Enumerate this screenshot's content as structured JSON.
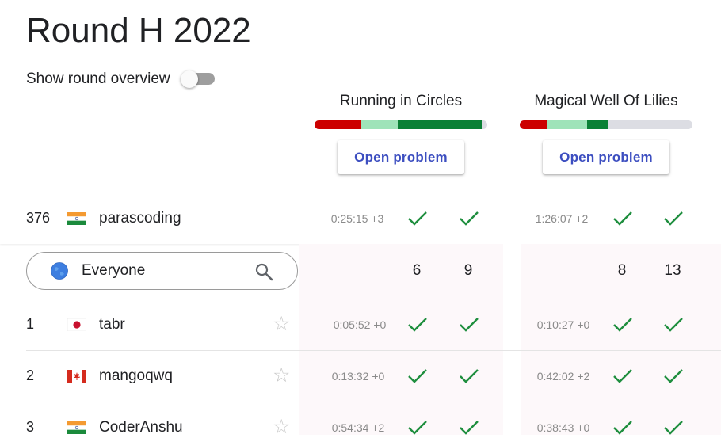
{
  "page": {
    "title": "Round H 2022"
  },
  "overview": {
    "label": "Show round overview",
    "toggle_on": false
  },
  "problems": [
    {
      "name": "Running in Circles",
      "button": "Open problem",
      "progress": [
        {
          "fraction": 0.27,
          "color": "#cc0000"
        },
        {
          "fraction": 0.21,
          "color": "#9fe3b9"
        },
        {
          "fraction": 0.49,
          "color": "#0a8035"
        }
      ]
    },
    {
      "name": "Magical Well Of Lilies",
      "button": "Open problem",
      "progress": [
        {
          "fraction": 0.16,
          "color": "#cc0000"
        },
        {
          "fraction": 0.23,
          "color": "#9fe3b9"
        },
        {
          "fraction": 0.12,
          "color": "#0a8035"
        }
      ]
    }
  ],
  "me": {
    "rank": "376",
    "flag": "india",
    "name": "parascoding",
    "p1": {
      "time": "0:25:15 +3",
      "solved": [
        true,
        true
      ]
    },
    "p2": {
      "time": "1:26:07 +2",
      "solved": [
        true,
        true
      ]
    }
  },
  "filter": {
    "icon": "globe-icon",
    "label": "Everyone"
  },
  "counts": {
    "p1": [
      "6",
      "9"
    ],
    "p2": [
      "8",
      "13"
    ]
  },
  "rows": [
    {
      "rank": "1",
      "flag": "japan",
      "name": "tabr",
      "p1": {
        "time": "0:05:52 +0"
      },
      "p2": {
        "time": "0:10:27 +0"
      }
    },
    {
      "rank": "2",
      "flag": "canada",
      "name": "mangoqwq",
      "p1": {
        "time": "0:13:32 +0"
      },
      "p2": {
        "time": "0:42:02 +2"
      }
    },
    {
      "rank": "3",
      "flag": "india",
      "name": "CoderAnshu",
      "p1": {
        "time": "0:54:34 +2"
      },
      "p2": {
        "time": "0:38:43 +0"
      }
    }
  ],
  "colors": {
    "check": "#1e8e3e",
    "accent": "#3c4ec0"
  }
}
